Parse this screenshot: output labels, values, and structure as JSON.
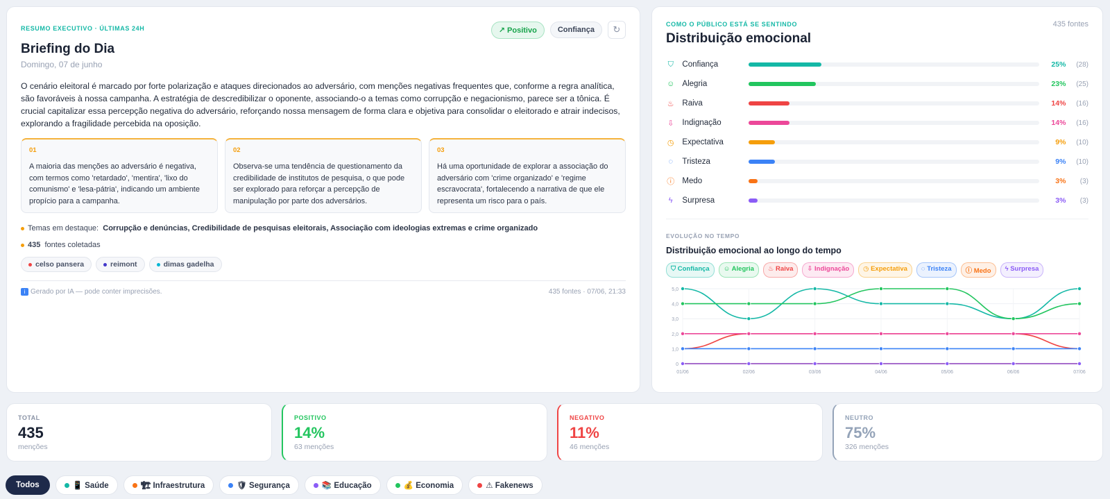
{
  "briefing": {
    "eyebrow": "RESUMO EXECUTIVO · ÚLTIMAS 24H",
    "badge_positive": "↗ Positivo",
    "badge_confidence": "Confiança",
    "refresh_icon": "↻",
    "title": "Briefing do Dia",
    "date": "Domingo, 07 de junho",
    "summary": "O cenário eleitoral é marcado por forte polarização e ataques direcionados ao adversário, com menções negativas frequentes que, conforme a regra analítica, são favoráveis à nossa campanha. A estratégia de descredibilizar o oponente, associando-o a temas como corrupção e negacionismo, parece ser a tônica. É crucial capitalizar essa percepção negativa do adversário, reforçando nossa mensagem de forma clara e objetiva para consolidar o eleitorado e atrair indecisos, explorando a fragilidade percebida na oposição.",
    "insights": [
      {
        "num": "01",
        "text": "A maioria das menções ao adversário é negativa, com termos como 'retardado', 'mentira', 'lixo do comunismo' e 'lesa-pátria', indicando um ambiente propício para a campanha."
      },
      {
        "num": "02",
        "text": "Observa-se uma tendência de questionamento da credibilidade de institutos de pesquisa, o que pode ser explorado para reforçar a percepção de manipulação por parte dos adversários."
      },
      {
        "num": "03",
        "text": "Há uma oportunidade de explorar a associação do adversário com 'crime organizado' e 'regime escravocrata', fortalecendo a narrativa de que ele representa um risco para o país."
      }
    ],
    "themes_label": "Temas em destaque:",
    "themes_value": "Corrupção e denúncias, Credibilidade de pesquisas eleitorais, Associação com ideologias extremas e crime organizado",
    "sources_count": "435",
    "sources_label": "fontes coletadas",
    "authors": [
      {
        "name": "celso pansera",
        "color": "#ef4444"
      },
      {
        "name": "reimont",
        "color": "#4338ca"
      },
      {
        "name": "dimas gadelha",
        "color": "#06b6d4"
      }
    ],
    "footer_ai_icon": "i",
    "footer_left": "Gerado por IA — pode conter imprecisões.",
    "footer_right": "435 fontes · 07/06, 21:33"
  },
  "emotions": {
    "eyebrow": "COMO O PÚBLICO ESTÁ SE SENTINDO",
    "title": "Distribuição emocional",
    "sources": "435 fontes",
    "items": [
      {
        "name": "Confiança",
        "icon": "shield-check",
        "glyph": "⛉",
        "pct": "25%",
        "value": 25,
        "count": "(28)",
        "color": "#14b8a6"
      },
      {
        "name": "Alegria",
        "icon": "smile",
        "glyph": "☺",
        "pct": "23%",
        "value": 23,
        "count": "(25)",
        "color": "#22c55e"
      },
      {
        "name": "Raiva",
        "icon": "flame",
        "glyph": "♨",
        "pct": "14%",
        "value": 14,
        "count": "(16)",
        "color": "#ef4444"
      },
      {
        "name": "Indignação",
        "icon": "thumbs-down",
        "glyph": "⇩",
        "pct": "14%",
        "value": 14,
        "count": "(16)",
        "color": "#ec4899"
      },
      {
        "name": "Expectativa",
        "icon": "clock",
        "glyph": "◷",
        "pct": "9%",
        "value": 9,
        "count": "(10)",
        "color": "#f59e0b"
      },
      {
        "name": "Tristeza",
        "icon": "droplet",
        "glyph": "◌",
        "pct": "9%",
        "value": 9,
        "count": "(10)",
        "color": "#3b82f6"
      },
      {
        "name": "Medo",
        "icon": "alert-circle",
        "glyph": "ⓘ",
        "pct": "3%",
        "value": 3,
        "count": "(3)",
        "color": "#f97316"
      },
      {
        "name": "Surpresa",
        "icon": "zap",
        "glyph": "ϟ",
        "pct": "3%",
        "value": 3,
        "count": "(3)",
        "color": "#8b5cf6"
      }
    ],
    "evo_eyebrow": "EVOLUÇÃO NO TEMPO",
    "evo_title": "Distribuição emocional ao longo do tempo"
  },
  "chart_data": {
    "type": "line",
    "x": [
      "01/06",
      "02/06",
      "03/06",
      "04/06",
      "05/06",
      "06/06",
      "07/06"
    ],
    "ylim": [
      0,
      5
    ],
    "yticks": [
      "0",
      "1,0",
      "2,0",
      "3,0",
      "4,0",
      "5,0"
    ],
    "series": [
      {
        "name": "Confiança",
        "color": "#14b8a6",
        "values": [
          5,
          3,
          5,
          4,
          4,
          3,
          5
        ]
      },
      {
        "name": "Alegria",
        "color": "#22c55e",
        "values": [
          4,
          4,
          4,
          5,
          5,
          3,
          4
        ]
      },
      {
        "name": "Raiva",
        "color": "#ef4444",
        "values": [
          1,
          2,
          2,
          2,
          2,
          2,
          1
        ]
      },
      {
        "name": "Indignação",
        "color": "#ec4899",
        "values": [
          2,
          2,
          2,
          2,
          2,
          2,
          2
        ]
      },
      {
        "name": "Expectativa",
        "color": "#f59e0b",
        "values": [
          0,
          0,
          0,
          0,
          0,
          0,
          0
        ]
      },
      {
        "name": "Tristeza",
        "color": "#3b82f6",
        "values": [
          1,
          1,
          1,
          1,
          1,
          1,
          1
        ]
      },
      {
        "name": "Medo",
        "color": "#f97316",
        "values": [
          0,
          0,
          0,
          0,
          0,
          0,
          0
        ]
      },
      {
        "name": "Surpresa",
        "color": "#8b5cf6",
        "values": [
          0,
          0,
          0,
          0,
          0,
          0,
          0
        ]
      }
    ],
    "legend": [
      {
        "label": "⛉ Confiança",
        "color": "#14b8a6",
        "bg": "#e7f8f5"
      },
      {
        "label": "☺ Alegria",
        "color": "#22c55e",
        "bg": "#e9f9ef"
      },
      {
        "label": "♨ Raiva",
        "color": "#ef4444",
        "bg": "#fdecec"
      },
      {
        "label": "⇩ Indignação",
        "color": "#ec4899",
        "bg": "#fdeaf3"
      },
      {
        "label": "◷ Expectativa",
        "color": "#f59e0b",
        "bg": "#fef5e6"
      },
      {
        "label": "◌ Tristeza",
        "color": "#3b82f6",
        "bg": "#ebf2fe"
      },
      {
        "label": "ⓘ Medo",
        "color": "#f97316",
        "bg": "#fef0e6"
      },
      {
        "label": "ϟ Surpresa",
        "color": "#8b5cf6",
        "bg": "#f3effe"
      }
    ]
  },
  "kpis": [
    {
      "label": "TOTAL",
      "value": "435",
      "sub": "menções",
      "color": "#1a2233",
      "border": "#e3e7ee"
    },
    {
      "label": "POSITIVO",
      "value": "14%",
      "sub": "63 menções",
      "color": "#22c55e",
      "border": "#22c55e"
    },
    {
      "label": "NEGATIVO",
      "value": "11%",
      "sub": "46 menções",
      "color": "#ef4444",
      "border": "#ef4444"
    },
    {
      "label": "NEUTRO",
      "value": "75%",
      "sub": "326 menções",
      "color": "#94a3b8",
      "border": "#94a3b8"
    }
  ],
  "categories": [
    {
      "label": "Todos",
      "active": true
    },
    {
      "label": "📱 Saúde",
      "color": "#14b8a6"
    },
    {
      "label": "🏗 Infraestrutura",
      "color": "#f97316"
    },
    {
      "label": "🛡 Segurança",
      "color": "#3b82f6"
    },
    {
      "label": "📚 Educação",
      "color": "#8b5cf6"
    },
    {
      "label": "💰 Economia",
      "color": "#22c55e"
    },
    {
      "label": "⚠ Fakenews",
      "color": "#ef4444"
    }
  ]
}
